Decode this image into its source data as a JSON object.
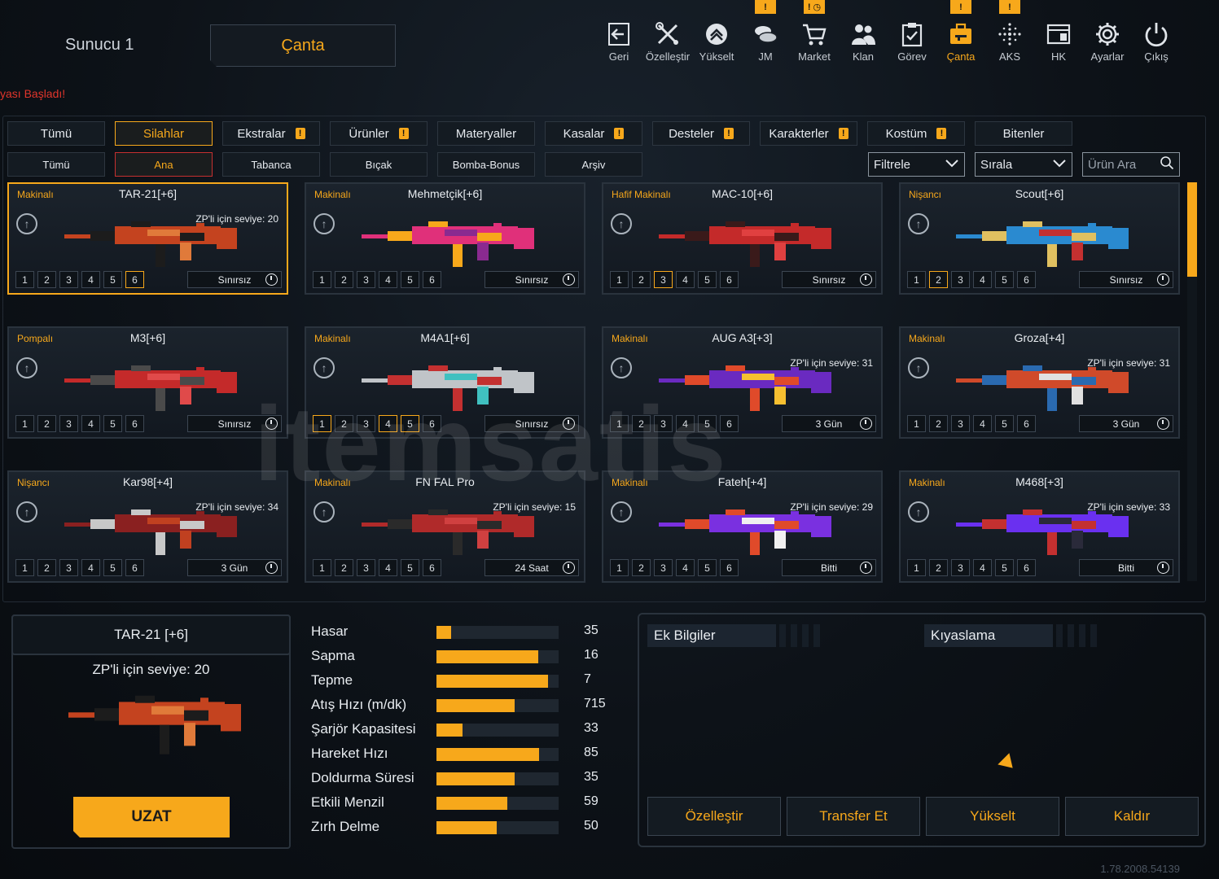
{
  "header": {
    "server_name": "Sunucu 1",
    "section_title": "Çanta",
    "ticker": "yası Başladı!"
  },
  "nav": [
    {
      "label": "Geri",
      "icon": "back-icon",
      "alert": ""
    },
    {
      "label": "Özelleştir",
      "icon": "tools-icon",
      "alert": ""
    },
    {
      "label": "Yükselt",
      "icon": "upgrade-icon",
      "alert": ""
    },
    {
      "label": "JM",
      "icon": "coins-icon",
      "alert": "!"
    },
    {
      "label": "Market",
      "icon": "cart-icon",
      "alert": "! ◷"
    },
    {
      "label": "Klan",
      "icon": "clan-icon",
      "alert": ""
    },
    {
      "label": "Görev",
      "icon": "clipboard-icon",
      "alert": ""
    },
    {
      "label": "Çanta",
      "icon": "bag-icon",
      "alert": "!",
      "active": true
    },
    {
      "label": "AKS",
      "icon": "aks-icon",
      "alert": "!"
    },
    {
      "label": "HK",
      "icon": "hk-icon",
      "alert": ""
    },
    {
      "label": "Ayarlar",
      "icon": "gear-icon",
      "alert": ""
    },
    {
      "label": "Çıkış",
      "icon": "power-icon",
      "alert": ""
    }
  ],
  "categories": [
    {
      "label": "Tümü",
      "warn": false
    },
    {
      "label": "Silahlar",
      "warn": false,
      "active": true
    },
    {
      "label": "Ekstralar",
      "warn": true
    },
    {
      "label": "Ürünler",
      "warn": true
    },
    {
      "label": "Materyaller",
      "warn": false
    },
    {
      "label": "Kasalar",
      "warn": true
    },
    {
      "label": "Desteler",
      "warn": true
    },
    {
      "label": "Karakterler",
      "warn": true
    },
    {
      "label": "Kostüm",
      "warn": true
    },
    {
      "label": "Bitenler",
      "warn": false
    }
  ],
  "subcategories": [
    {
      "label": "Tümü"
    },
    {
      "label": "Ana",
      "active": true
    },
    {
      "label": "Tabanca"
    },
    {
      "label": "Bıçak"
    },
    {
      "label": "Bomba-Bonus"
    },
    {
      "label": "Arşiv"
    }
  ],
  "filters": {
    "filter_label": "Filtrele",
    "sort_label": "Sırala",
    "search_placeholder": "Ürün Ara"
  },
  "items": [
    {
      "category": "Makinalı",
      "name": "TAR-21[+6]",
      "req": "ZP'li için seviye: 20",
      "duration": "Sınırsız",
      "active_levels": [
        6
      ],
      "selected": true,
      "colors": [
        "#c4431f",
        "#1c1c1c",
        "#e07a3a"
      ]
    },
    {
      "category": "Makinalı",
      "name": "Mehmetçik[+6]",
      "req": "",
      "duration": "Sınırsız",
      "active_levels": [],
      "colors": [
        "#e0307a",
        "#f7a81b",
        "#8a2a90"
      ]
    },
    {
      "category": "Hafif Makinalı",
      "name": "MAC-10[+6]",
      "req": "",
      "duration": "Sınırsız",
      "active_levels": [
        3
      ],
      "colors": [
        "#c42a2a",
        "#3a1a1a",
        "#e04040"
      ]
    },
    {
      "category": "Nişancı",
      "name": "Scout[+6]",
      "req": "",
      "duration": "Sınırsız",
      "active_levels": [
        2
      ],
      "colors": [
        "#2a8ad0",
        "#e0c060",
        "#c43030"
      ]
    },
    {
      "category": "Pompalı",
      "name": "M3[+6]",
      "req": "",
      "duration": "Sınırsız",
      "active_levels": [],
      "colors": [
        "#c42a2a",
        "#4a4a4a",
        "#e04a4a"
      ]
    },
    {
      "category": "Makinalı",
      "name": "M4A1[+6]",
      "req": "",
      "duration": "Sınırsız",
      "active_levels": [
        1,
        4,
        5
      ],
      "colors": [
        "#c0c4c8",
        "#c43030",
        "#40c0c0"
      ]
    },
    {
      "category": "Makinalı",
      "name": "AUG A3[+3]",
      "req": "ZP'li için seviye: 31",
      "duration": "3 Gün",
      "active_levels": [],
      "colors": [
        "#6a2ac0",
        "#e04a2a",
        "#f7c030"
      ]
    },
    {
      "category": "Makinalı",
      "name": "Groza[+4]",
      "req": "ZP'li için seviye: 31",
      "duration": "3 Gün",
      "active_levels": [],
      "colors": [
        "#d04a2a",
        "#2a6ab0",
        "#e0e0e0"
      ]
    },
    {
      "category": "Nişancı",
      "name": "Kar98[+4]",
      "req": "ZP'li için seviye: 34",
      "duration": "3 Gün",
      "active_levels": [],
      "colors": [
        "#8a2020",
        "#c8c8c8",
        "#c04020"
      ]
    },
    {
      "category": "Makinalı",
      "name": "FN FAL Pro",
      "req": "ZP'li için seviye: 15",
      "duration": "24 Saat",
      "active_levels": [],
      "colors": [
        "#b02a2a",
        "#2a2a2a",
        "#d04040"
      ]
    },
    {
      "category": "Makinalı",
      "name": "Fateh[+4]",
      "req": "ZP'li için seviye: 29",
      "duration": "Bitti",
      "active_levels": [],
      "colors": [
        "#7a30e0",
        "#e04a2a",
        "#f0f0f0"
      ]
    },
    {
      "category": "Makinalı",
      "name": "M468[+3]",
      "req": "ZP'li için seviye: 33",
      "duration": "Bitti",
      "active_levels": [],
      "colors": [
        "#6a30f0",
        "#c43030",
        "#2a2a3a"
      ]
    }
  ],
  "levels": [
    "1",
    "2",
    "3",
    "4",
    "5",
    "6"
  ],
  "watermark": "itemsatis",
  "detail": {
    "name": "TAR-21 [+6]",
    "req": "ZP'li için seviye: 20",
    "extend_label": "UZAT"
  },
  "stats": [
    {
      "label": "Hasar",
      "value": "35",
      "fill": 0.12
    },
    {
      "label": "Sapma",
      "value": "16",
      "fill": 0.83
    },
    {
      "label": "Tepme",
      "value": "7",
      "fill": 0.91
    },
    {
      "label": "Atış Hızı (m/dk)",
      "value": "715",
      "fill": 0.64
    },
    {
      "label": "Şarjör Kapasitesi",
      "value": "33",
      "fill": 0.21
    },
    {
      "label": "Hareket Hızı",
      "value": "85",
      "fill": 0.84
    },
    {
      "label": "Doldurma Süresi",
      "value": "35",
      "fill": 0.64
    },
    {
      "label": "Etkili Menzil",
      "value": "59",
      "fill": 0.58
    },
    {
      "label": "Zırh Delme",
      "value": "50",
      "fill": 0.49
    }
  ],
  "info": {
    "extra_label": "Ek Bilgiler",
    "compare_label": "Kıyaslama"
  },
  "actions": [
    "Özelleştir",
    "Transfer Et",
    "Yükselt",
    "Kaldır"
  ],
  "version": "1.78.2008.54139",
  "accent_color": "#f7a81b"
}
